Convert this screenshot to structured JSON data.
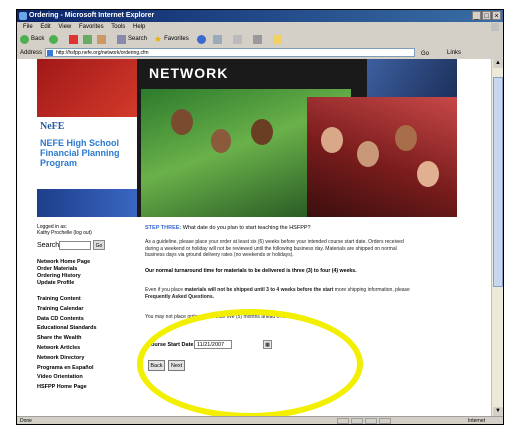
{
  "window": {
    "title": "Ordering - Microsoft Internet Explorer"
  },
  "menu": [
    "File",
    "Edit",
    "View",
    "Favorites",
    "Tools",
    "Help"
  ],
  "toolbar": {
    "back": "Back",
    "search": "Search",
    "favorites": "Favorites"
  },
  "address": {
    "label": "Address",
    "url": "http://hsfpp.nefe.org/network/ordering.cfm",
    "go": "Go",
    "links": "Links"
  },
  "banner": {
    "title": "NETWORK",
    "logo": "NeFE",
    "program": "NEFE High School Financial Planning Program"
  },
  "sidebar": {
    "login_line1": "Logged in as:",
    "login_line2": "Kathy Prochelle (log out)",
    "search_label": "Search",
    "go": "Go",
    "nav_primary": [
      "Network Home Page",
      "Order Materials",
      "Ordering History",
      "Update Profile"
    ],
    "nav_secondary": [
      "Training Content",
      "Training Calendar",
      "Data CD Contents",
      "Educational Standards",
      "Share the Wealth",
      "Network Articles",
      "Network Directory",
      "Programa en Español",
      "Video Orientation",
      "HSFPP Home Page"
    ]
  },
  "main": {
    "step_head": "STEP THREE:",
    "step_text": "What date do you plan to start teaching the HSFPP?",
    "guideline": "As a guideline, please place your order at least six (6) weeks before your intended course start date. Orders received during a weekend or holiday will not be reviewed until the following business day. Materials are shipped on normal business days via ground delivery rates (no weekends or holidays).",
    "turnaround": "Our normal turnaround time for materials to be delivered is three (3) to four (4) weeks.",
    "even_if_a": "Even if you place ",
    "even_if_b": "materials will not be shipped until 3 to 4 weeks before the",
    "even_if_c": "start",
    "even_if_d": " more shipping information, please",
    "even_if_e": "Frequently Asked Questions.",
    "month_note": "You may not place orders more than five (5) months ahead of time.",
    "date_label": "Course Start Date:",
    "date_value": "11/21/2007",
    "back_button": "Back",
    "next_button": "Next"
  },
  "status": {
    "text": "Done",
    "zone": "Internet"
  },
  "colors": {
    "accent_blue": "#3a6ad0",
    "highlight": "#f2ef00",
    "titlebar": "#0a246a"
  }
}
